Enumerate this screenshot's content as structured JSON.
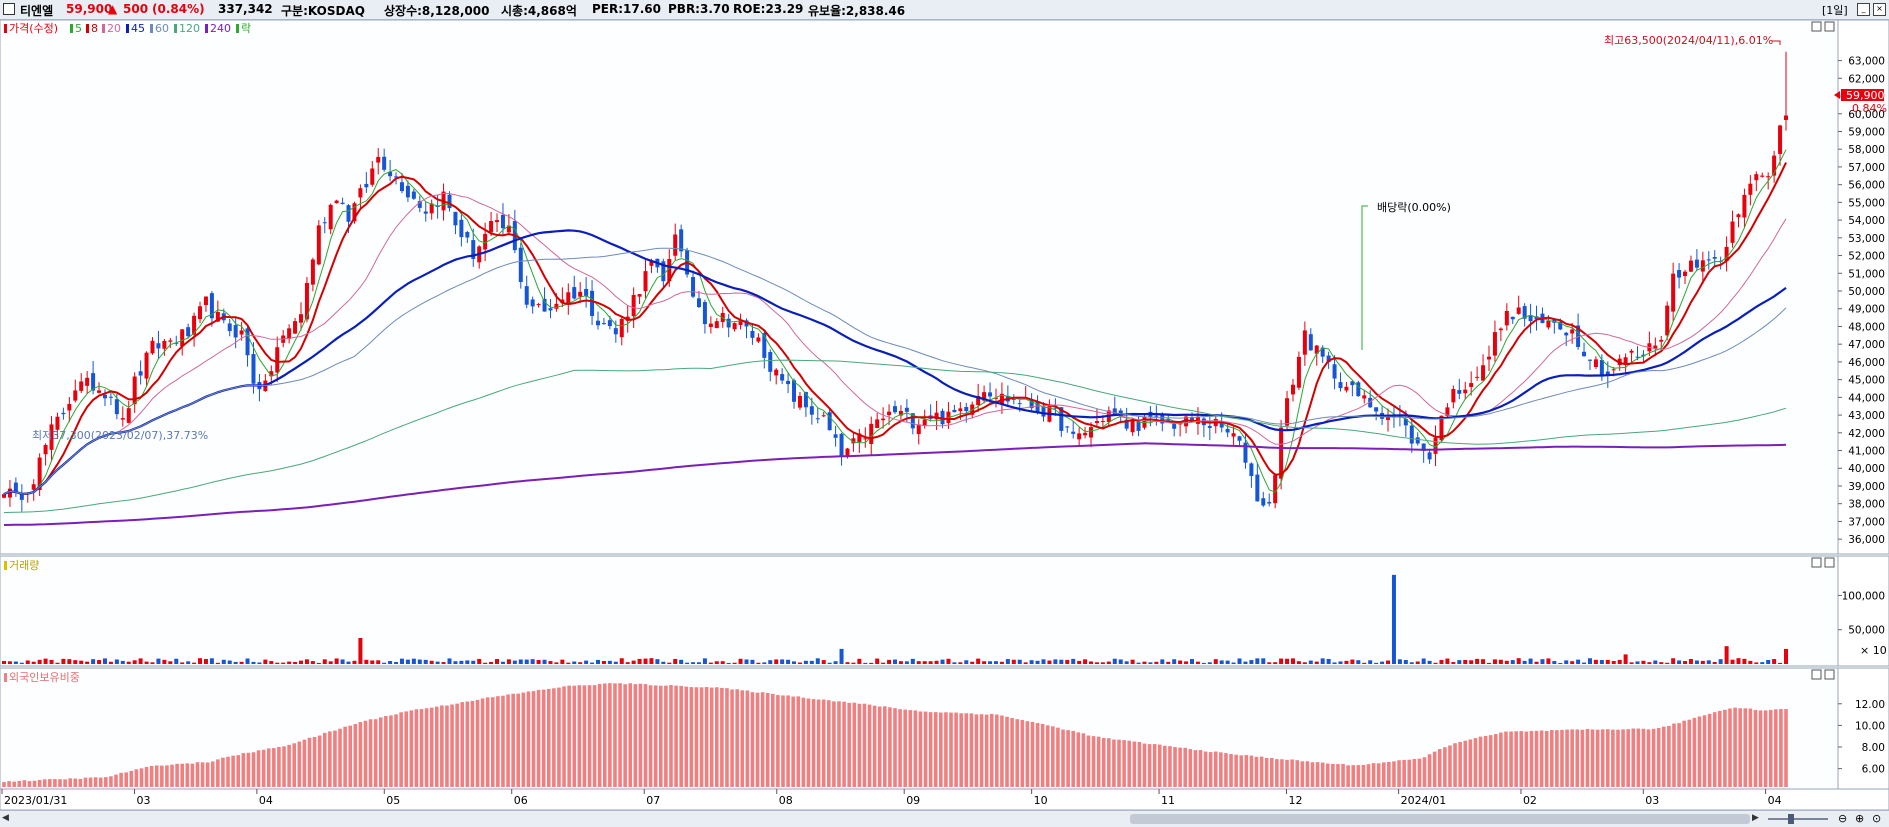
{
  "header": {
    "stock_name": "티엔엘",
    "price": "59,900",
    "change_arrow": "▲",
    "change": "500",
    "change_pct": "(0.84%)",
    "volume": "337,342",
    "market": "구분:KOSDAQ",
    "shares": "상장수:8,128,000",
    "market_cap": "시총:4,868억",
    "per": "PER:17.60",
    "pbr": "PBR:3.70",
    "roe": "ROE:23.29",
    "float": "유보율:2,838.46",
    "period": "[1일]"
  },
  "colors": {
    "up": "#e8000c",
    "down": "#1656d6",
    "ma5": "#2ea82e",
    "ma8": "#d40000",
    "ma20": "#d2679a",
    "ma45": "#0a1fb8",
    "ma60": "#6f8ab8",
    "ma120": "#4aa87a",
    "ma240": "#7a1fb8",
    "foreign": "#f08080",
    "bg": "#fdfeff"
  },
  "panels": {
    "price_legend": {
      "label": "가격(수정)",
      "ma": [
        "5",
        "8",
        "20",
        "45",
        "60",
        "120",
        "240"
      ],
      "ex": "락"
    },
    "volume_legend": "거래량",
    "foreign_legend": "외국인보유비중"
  },
  "annotations": {
    "high": "최고63,500(2024/04/11),6.01%",
    "low": "최저37,300(2023/02/07),37.73%",
    "dividend": "배당락(0.00%)",
    "current_price": "59,900",
    "current_pct": "0.84%",
    "volume_unit": "× 10"
  },
  "chart_data": [
    {
      "type": "candlestick",
      "title": "가격(수정)",
      "x_ticks": [
        "2023/01/31",
        "03",
        "04",
        "05",
        "06",
        "07",
        "08",
        "09",
        "10",
        "11",
        "12",
        "2024/01",
        "02",
        "03",
        "04"
      ],
      "y_ticks": [
        "36,000",
        "37,000",
        "38,000",
        "39,000",
        "40,000",
        "41,000",
        "42,000",
        "43,000",
        "44,000",
        "45,000",
        "46,000",
        "47,000",
        "48,000",
        "49,000",
        "50,000",
        "51,000",
        "52,000",
        "53,000",
        "54,000",
        "55,000",
        "56,000",
        "57,000",
        "58,000",
        "59,000",
        "60,000",
        "61,000",
        "62,000",
        "63,000"
      ],
      "ylim": [
        35500,
        64500
      ],
      "close_path": [
        [
          0,
          38900
        ],
        [
          2,
          38200
        ],
        [
          5,
          39500
        ],
        [
          8,
          42100
        ],
        [
          10,
          43200
        ],
        [
          12,
          44600
        ],
        [
          15,
          44700
        ],
        [
          18,
          44200
        ],
        [
          20,
          42500
        ],
        [
          22,
          44800
        ],
        [
          25,
          46800
        ],
        [
          28,
          47200
        ],
        [
          31,
          47600
        ],
        [
          34,
          49300
        ],
        [
          37,
          48000
        ],
        [
          40,
          47600
        ],
        [
          42,
          45000
        ],
        [
          44,
          44500
        ],
        [
          46,
          46800
        ],
        [
          50,
          48800
        ],
        [
          53,
          53500
        ],
        [
          56,
          55500
        ],
        [
          58,
          54200
        ],
        [
          61,
          56000
        ],
        [
          63,
          57600
        ],
        [
          65,
          56800
        ],
        [
          68,
          55600
        ],
        [
          71,
          54600
        ],
        [
          74,
          55400
        ],
        [
          76,
          53800
        ],
        [
          79,
          52100
        ],
        [
          82,
          53600
        ],
        [
          85,
          53500
        ],
        [
          88,
          49400
        ],
        [
          91,
          48800
        ],
        [
          94,
          49700
        ],
        [
          97,
          50000
        ],
        [
          100,
          48500
        ],
        [
          103,
          47600
        ],
        [
          106,
          49600
        ],
        [
          109,
          51500
        ],
        [
          111,
          50400
        ],
        [
          113,
          53500
        ],
        [
          115,
          50500
        ],
        [
          118,
          48500
        ],
        [
          121,
          48500
        ],
        [
          124,
          48100
        ],
        [
          127,
          47200
        ],
        [
          130,
          45200
        ],
        [
          133,
          44000
        ],
        [
          136,
          43200
        ],
        [
          138,
          42700
        ],
        [
          141,
          40700
        ],
        [
          144,
          41600
        ],
        [
          147,
          42600
        ],
        [
          150,
          43200
        ],
        [
          153,
          42700
        ],
        [
          156,
          43000
        ],
        [
          159,
          42800
        ],
        [
          162,
          43600
        ],
        [
          165,
          44600
        ],
        [
          168,
          44000
        ],
        [
          171,
          43800
        ],
        [
          174,
          43400
        ],
        [
          177,
          43000
        ],
        [
          180,
          41600
        ],
        [
          183,
          42300
        ],
        [
          186,
          43200
        ],
        [
          189,
          42400
        ],
        [
          192,
          42600
        ],
        [
          195,
          42600
        ],
        [
          198,
          42500
        ],
        [
          201,
          42700
        ],
        [
          204,
          42400
        ],
        [
          207,
          41800
        ],
        [
          209,
          40600
        ],
        [
          211,
          38400
        ],
        [
          213,
          37800
        ],
        [
          215,
          42200
        ],
        [
          217,
          45000
        ],
        [
          219,
          47600
        ],
        [
          221,
          46500
        ],
        [
          223,
          45700
        ],
        [
          226,
          44600
        ],
        [
          229,
          43800
        ],
        [
          232,
          43200
        ],
        [
          235,
          42700
        ],
        [
          238,
          41200
        ],
        [
          240,
          40800
        ],
        [
          243,
          43800
        ],
        [
          246,
          44800
        ],
        [
          249,
          45500
        ],
        [
          252,
          48300
        ],
        [
          255,
          48800
        ],
        [
          258,
          48000
        ],
        [
          261,
          48300
        ],
        [
          264,
          47700
        ],
        [
          267,
          46300
        ],
        [
          270,
          45300
        ],
        [
          273,
          46300
        ],
        [
          276,
          46400
        ],
        [
          279,
          47500
        ],
        [
          281,
          50800
        ],
        [
          283,
          51500
        ],
        [
          285,
          51300
        ],
        [
          287,
          52100
        ],
        [
          289,
          51600
        ],
        [
          291,
          54200
        ],
        [
          293,
          55200
        ],
        [
          295,
          56400
        ],
        [
          297,
          56400
        ],
        [
          299,
          59400
        ],
        [
          300,
          59900
        ]
      ],
      "ma_legend": [
        "5",
        "8",
        "20",
        "45",
        "60",
        "120",
        "240"
      ],
      "high": {
        "date": "2024/04/11",
        "value": 63500,
        "pct": "6.01%"
      },
      "low": {
        "date": "2023/02/07",
        "value": 37300,
        "pct": "37.73%"
      },
      "last": {
        "value": 59900,
        "pct": "0.84%"
      }
    },
    {
      "type": "bar",
      "title": "거래량",
      "y_ticks": [
        "50,000",
        "100,000"
      ],
      "unit": "× 10",
      "ylim": [
        0,
        140000
      ],
      "spikes": [
        [
          60,
          38000
        ],
        [
          141,
          22000
        ],
        [
          234,
          130000
        ],
        [
          273,
          14000
        ],
        [
          290,
          26000
        ],
        [
          300,
          22000
        ]
      ]
    },
    {
      "type": "bar",
      "title": "외국인보유비중",
      "y_ticks": [
        "6.00",
        "8.00",
        "10.00",
        "12.00"
      ],
      "ylim": [
        4.3,
        14.2
      ],
      "level_path": [
        [
          0,
          4.8
        ],
        [
          20,
          5.2
        ],
        [
          25,
          5.8
        ],
        [
          30,
          6.3
        ],
        [
          40,
          6.6
        ],
        [
          45,
          7.2
        ],
        [
          55,
          8.1
        ],
        [
          60,
          8.8
        ],
        [
          70,
          10.3
        ],
        [
          80,
          11.4
        ],
        [
          86,
          11.8
        ],
        [
          93,
          12.4
        ],
        [
          110,
          13.6
        ],
        [
          120,
          13.9
        ],
        [
          140,
          13.5
        ],
        [
          155,
          12.7
        ],
        [
          170,
          11.9
        ],
        [
          180,
          11.3
        ],
        [
          195,
          11.0
        ],
        [
          205,
          10.0
        ],
        [
          215,
          8.9
        ],
        [
          230,
          8.0
        ],
        [
          240,
          7.4
        ],
        [
          255,
          6.7
        ],
        [
          265,
          6.3
        ],
        [
          278,
          6.9
        ],
        [
          285,
          8.4
        ],
        [
          295,
          9.4
        ],
        [
          310,
          9.6
        ],
        [
          325,
          9.7
        ],
        [
          335,
          11.1
        ],
        [
          340,
          11.7
        ],
        [
          345,
          11.4
        ],
        [
          350,
          11.5
        ]
      ]
    }
  ]
}
